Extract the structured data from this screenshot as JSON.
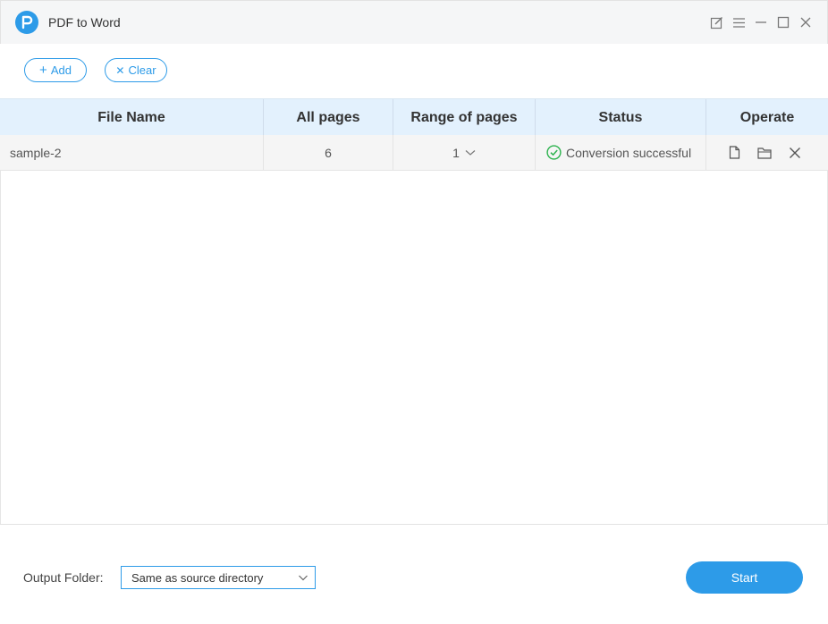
{
  "window": {
    "title": "PDF to Word",
    "controls": [
      "edit-icon",
      "menu-icon",
      "minimize-icon",
      "maximize-icon",
      "close-icon"
    ]
  },
  "toolbar": {
    "add_label": "Add",
    "add_icon": "+",
    "clear_label": "Clear",
    "clear_icon": "✕"
  },
  "table": {
    "columns": [
      "File Name",
      "All pages",
      "Range of pages",
      "Status",
      "Operate"
    ],
    "rows": [
      {
        "file_name": "sample-2",
        "all_pages": "6",
        "range": "1",
        "status": "Conversion successful",
        "operate_icons": [
          "file-icon",
          "folder-icon",
          "remove-icon"
        ]
      }
    ]
  },
  "footer": {
    "output_label": "Output Folder:",
    "output_value": "Same as source directory",
    "start_label": "Start"
  },
  "colors": {
    "accent": "#2d9be8",
    "header_bg": "#e3f1fd",
    "success": "#2bb24c"
  }
}
